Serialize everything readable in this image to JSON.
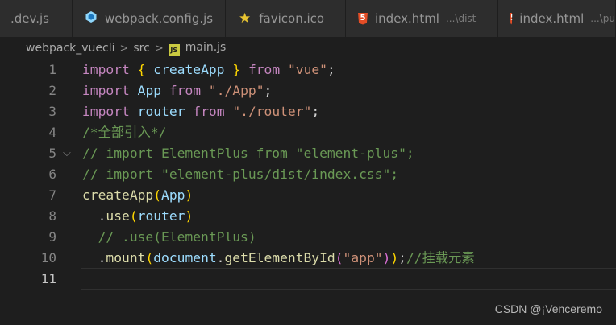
{
  "tabs": [
    {
      "label": ".dev.js",
      "icon": "none",
      "desc": ""
    },
    {
      "label": "webpack.config.js",
      "icon": "webpack-cube-icon",
      "desc": ""
    },
    {
      "label": "favicon.ico",
      "icon": "star-icon",
      "desc": ""
    },
    {
      "label": "index.html",
      "icon": "html5-icon",
      "desc": "...\\dist"
    },
    {
      "label": "index.html",
      "icon": "html5-icon",
      "desc": "...\\pu"
    }
  ],
  "breadcrumb": {
    "items": [
      "webpack_vuecli",
      "src",
      "main.js"
    ],
    "separator": ">",
    "file_icon_text": "JS"
  },
  "editor": {
    "language": "javascript",
    "active_line": 11,
    "folded_marker_line": 5,
    "fold_glyph": "⌵",
    "lines": [
      {
        "n": "1",
        "tokens": [
          [
            "kw",
            "import"
          ],
          [
            "p",
            " "
          ],
          [
            "b1",
            "{"
          ],
          [
            "p",
            " "
          ],
          [
            "id",
            "createApp"
          ],
          [
            "p",
            " "
          ],
          [
            "b1",
            "}"
          ],
          [
            "p",
            " "
          ],
          [
            "kw",
            "from"
          ],
          [
            "p",
            " "
          ],
          [
            "str",
            "\"vue\""
          ],
          [
            "p",
            ";"
          ]
        ]
      },
      {
        "n": "2",
        "tokens": [
          [
            "kw",
            "import"
          ],
          [
            "p",
            " "
          ],
          [
            "id",
            "App"
          ],
          [
            "p",
            " "
          ],
          [
            "kw",
            "from"
          ],
          [
            "p",
            " "
          ],
          [
            "str",
            "\"./App\""
          ],
          [
            "p",
            ";"
          ]
        ]
      },
      {
        "n": "3",
        "tokens": [
          [
            "kw",
            "import"
          ],
          [
            "p",
            " "
          ],
          [
            "id",
            "router"
          ],
          [
            "p",
            " "
          ],
          [
            "kw",
            "from"
          ],
          [
            "p",
            " "
          ],
          [
            "str",
            "\"./router\""
          ],
          [
            "p",
            ";"
          ]
        ]
      },
      {
        "n": "4",
        "tokens": [
          [
            "cm",
            "/*全部引入*/"
          ]
        ]
      },
      {
        "n": "5",
        "tokens": [
          [
            "cm",
            "// import ElementPlus from \"element-plus\";"
          ]
        ]
      },
      {
        "n": "6",
        "tokens": [
          [
            "cm",
            "// import \"element-plus/dist/index.css\";"
          ]
        ]
      },
      {
        "n": "7",
        "tokens": [
          [
            "fn",
            "createApp"
          ],
          [
            "b1",
            "("
          ],
          [
            "id",
            "App"
          ],
          [
            "b1",
            ")"
          ]
        ]
      },
      {
        "n": "8",
        "tokens": [
          [
            "p",
            "  ."
          ],
          [
            "fn",
            "use"
          ],
          [
            "b1",
            "("
          ],
          [
            "id",
            "router"
          ],
          [
            "b1",
            ")"
          ]
        ]
      },
      {
        "n": "9",
        "tokens": [
          [
            "p",
            "  "
          ],
          [
            "cm",
            "// .use(ElementPlus)"
          ]
        ]
      },
      {
        "n": "10",
        "tokens": [
          [
            "p",
            "  ."
          ],
          [
            "fn",
            "mount"
          ],
          [
            "b1",
            "("
          ],
          [
            "id",
            "document"
          ],
          [
            "p",
            "."
          ],
          [
            "fn",
            "getElementById"
          ],
          [
            "b2",
            "("
          ],
          [
            "str",
            "\"app\""
          ],
          [
            "b2",
            ")"
          ],
          [
            "b1",
            ")"
          ],
          [
            "p",
            ";"
          ],
          [
            "cm",
            "//挂载元素"
          ]
        ]
      },
      {
        "n": "11",
        "tokens": []
      }
    ]
  },
  "watermark": "CSDN @¡Venceremo",
  "colors": {
    "background": "#1e1e1e",
    "keyword": "#c586c0",
    "identifier": "#9cdcfe",
    "function": "#dcdcaa",
    "string": "#ce9178",
    "comment": "#6a9955",
    "bracket_level1": "#ffd700",
    "bracket_level2": "#da70d6"
  }
}
